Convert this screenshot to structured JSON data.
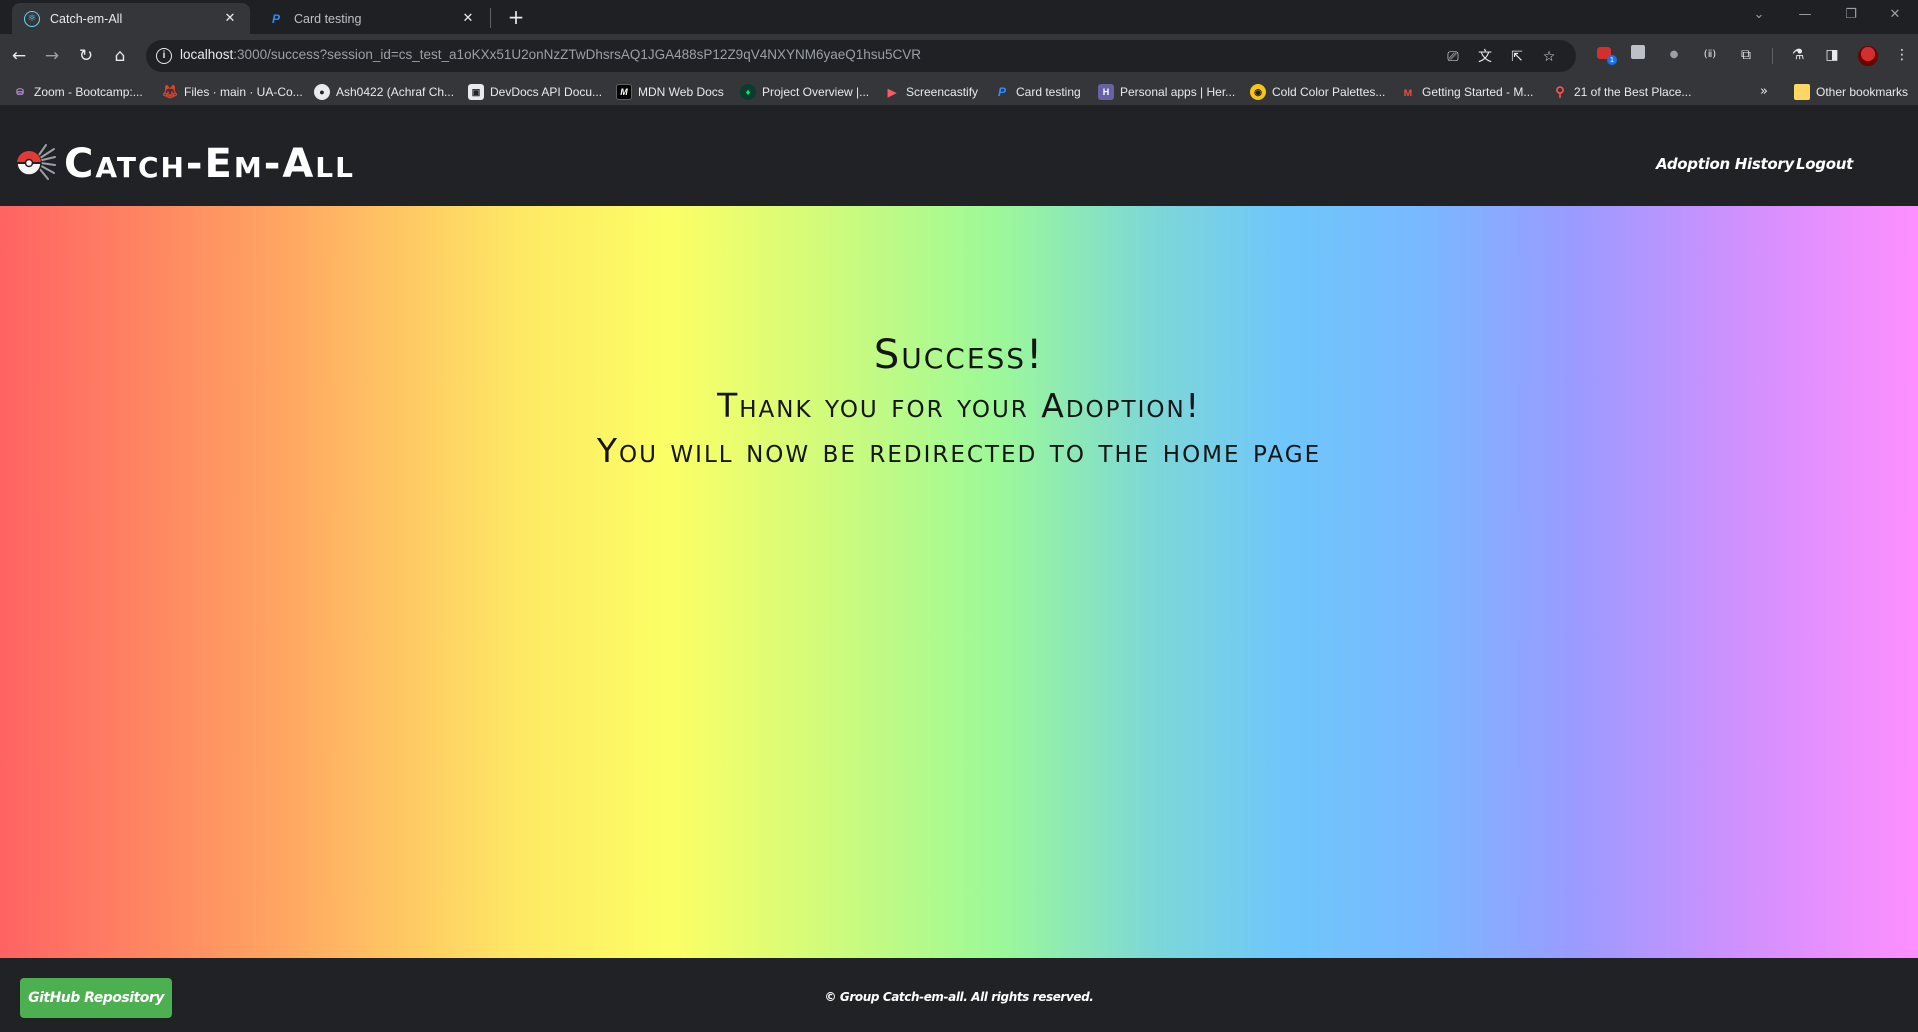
{
  "browser": {
    "tabs": [
      {
        "title": "Catch-em-All",
        "active": true,
        "icon": "react-icon"
      },
      {
        "title": "Card testing",
        "active": false,
        "icon": "paypal-icon"
      }
    ],
    "url_host": "localhost",
    "url_rest": ":3000/success?session_id=cs_test_a1oKXx51U2onNzZTwDhsrsAQ1JGA488sP12Z9qV4NXYNM6yaeQ1hsu5CVR",
    "bookmarks": [
      {
        "label": "Zoom - Bootcamp:...",
        "icon": "zoom-icon",
        "color": "#7a3a8a"
      },
      {
        "label": "Files · main · UA-Co...",
        "icon": "gitlab-icon",
        "color": "#e24329"
      },
      {
        "label": "Ash0422 (Achraf Ch...",
        "icon": "github-icon",
        "color": "#202124"
      },
      {
        "label": "DevDocs API Docu...",
        "icon": "devdocs-icon",
        "color": "#e8eaed"
      },
      {
        "label": "MDN Web Docs",
        "icon": "mdn-icon",
        "color": "#000000"
      },
      {
        "label": "Project Overview |...",
        "icon": "mongodb-icon",
        "color": "#0b3d2e"
      },
      {
        "label": "Screencastify",
        "icon": "screencastify-icon",
        "color": "#ff5a5f"
      },
      {
        "label": "Card testing",
        "icon": "paypal-icon",
        "color": "#003087"
      },
      {
        "label": "Personal apps | Her...",
        "icon": "heroku-icon",
        "color": "#6762a6"
      },
      {
        "label": "Cold Color Palettes...",
        "icon": "palette-icon",
        "color": "#f5c518"
      },
      {
        "label": "Getting Started - M...",
        "icon": "mui-icon",
        "color": "#e94b3c"
      },
      {
        "label": "21 of the Best Place...",
        "icon": "pin-icon",
        "color": "#ff5252"
      }
    ],
    "bookmarks_overflow": "»",
    "other_bookmarks": "Other bookmarks"
  },
  "site": {
    "title": "Catch-Em-All",
    "nav": {
      "adoption_history": "Adoption History",
      "logout": "Logout"
    },
    "hero": {
      "title": "Success!",
      "line1": "Thank you for your Adoption!",
      "line2": "You will now be redirected to the home page"
    },
    "footer": {
      "github_button": "GitHub Repository",
      "copyright": "© Group Catch-em-all. All rights reserved."
    }
  },
  "colors": {
    "header_bg": "#212225",
    "github_button": "#4caf50",
    "gradient": [
      "#ff6363",
      "#ffa262",
      "#fee864",
      "#fbff65",
      "#9cf998",
      "#6fc6fb",
      "#9a9bff",
      "#ff8fff"
    ]
  }
}
